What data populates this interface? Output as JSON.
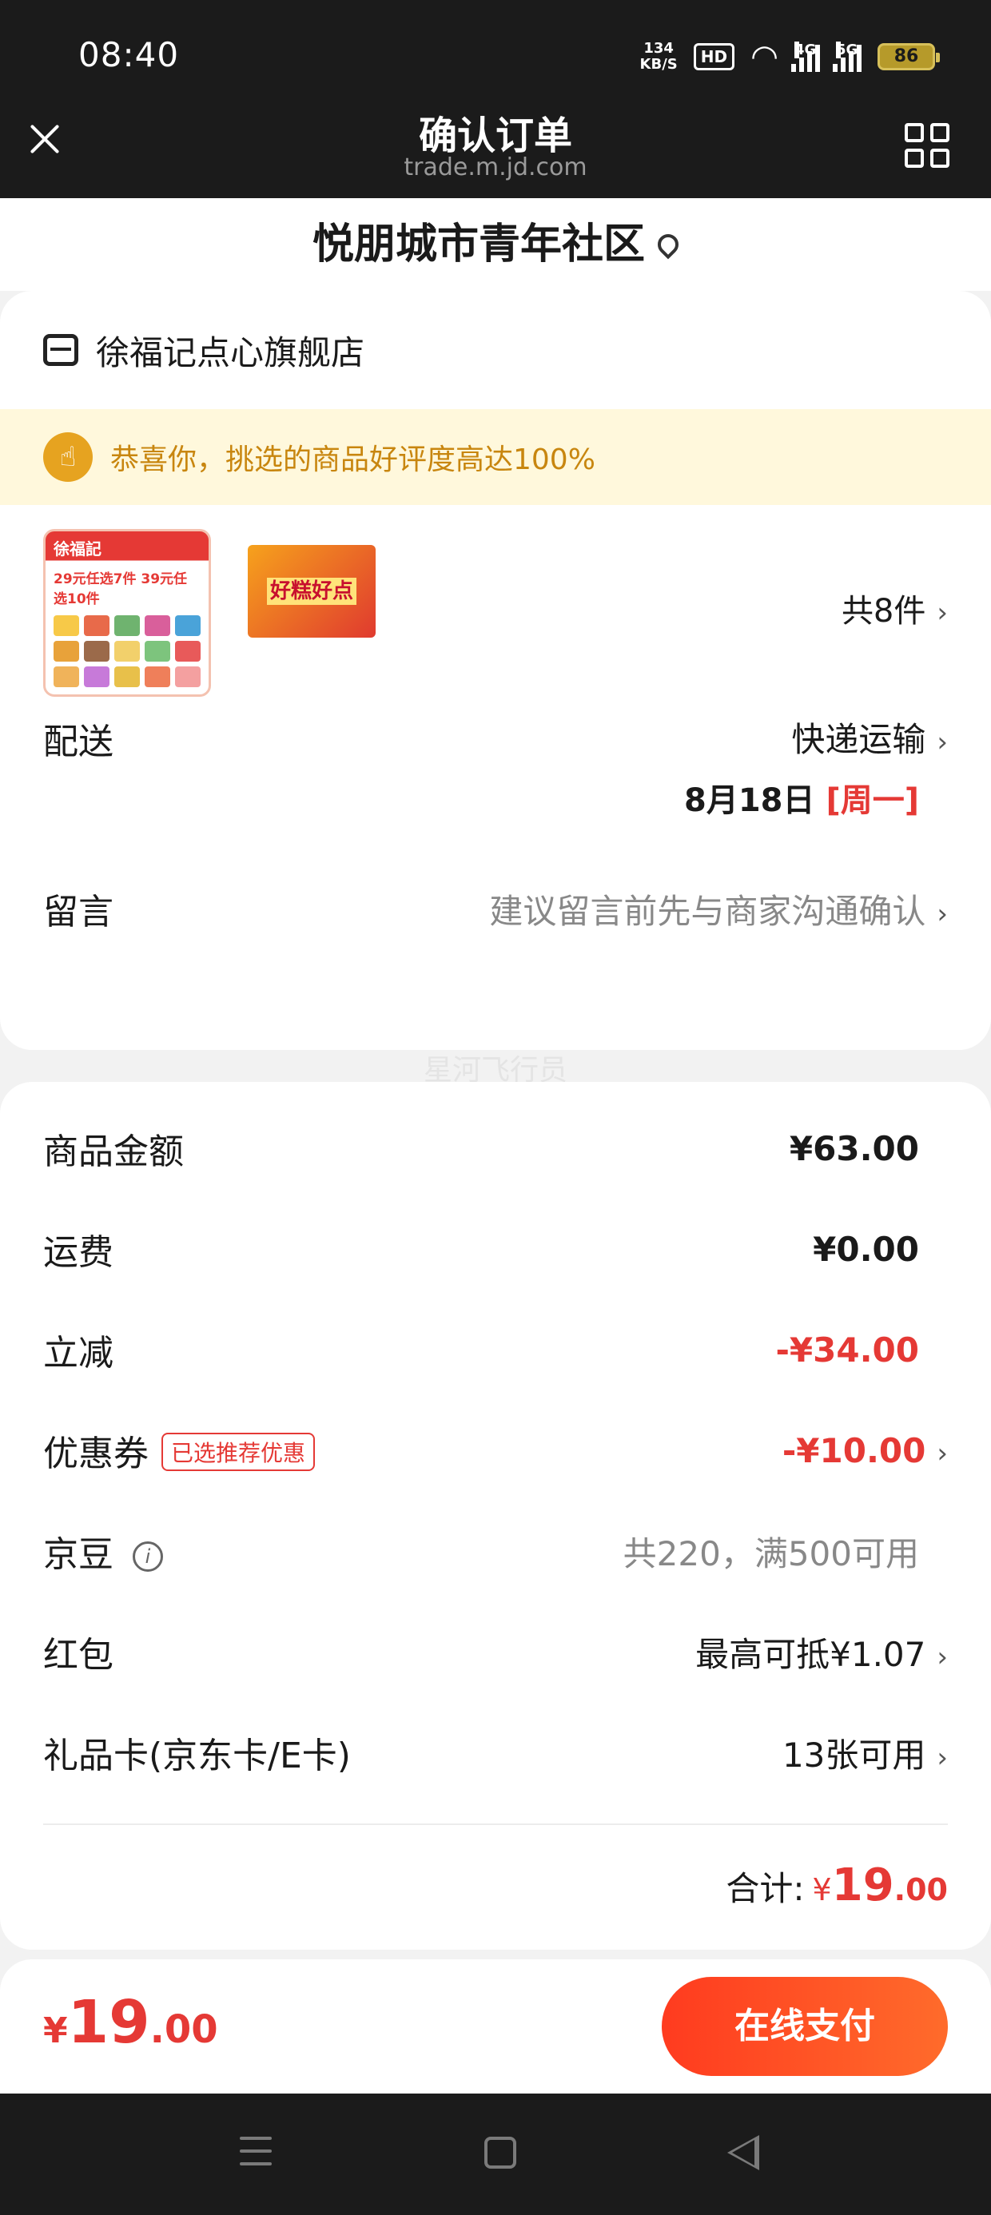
{
  "status_bar": {
    "time": "08:40",
    "speed_value": "134",
    "speed_unit": "KB/S",
    "hd_label": "HD",
    "net1_label": "4G",
    "net2_label": "5G",
    "battery": "86"
  },
  "header": {
    "title": "确认订单",
    "url": "trade.m.jd.com"
  },
  "address": {
    "name": "悦朋城市青年社区"
  },
  "store": {
    "name": "徐福记点心旗舰店"
  },
  "praise": {
    "text": "恭喜你，挑选的商品好评度高达100%"
  },
  "goods": {
    "product1_brand": "徐福記",
    "product1_promo": "29元任选7件 39元任选10件",
    "product2_title": "好糕好点",
    "count_label": "共8件"
  },
  "delivery": {
    "label": "配送",
    "method": "快递运输",
    "date": "8月18日",
    "weekday": "[周一]"
  },
  "message": {
    "label": "留言",
    "placeholder": "建议留言前先与商家沟通确认"
  },
  "watermark": "星河飞行员",
  "pricing": {
    "goods_amount_label": "商品金额",
    "goods_amount": "¥63.00",
    "shipping_label": "运费",
    "shipping": "¥0.00",
    "discount_label": "立减",
    "discount": "-¥34.00",
    "coupon_label": "优惠券",
    "coupon_badge": "已选推荐优惠",
    "coupon": "-¥10.00",
    "jingdou_label": "京豆",
    "jingdou": "共220，满500可用",
    "redpacket_label": "红包",
    "redpacket": "最高可抵¥1.07",
    "giftcard_label": "礼品卡(京东卡/E卡)",
    "giftcard": "13张可用",
    "total_label": "合计:",
    "total_currency": "¥",
    "total_int": "19",
    "total_dec": ".00"
  },
  "bottom": {
    "currency": "¥",
    "price_int": "19",
    "price_dec": ".00",
    "pay_label": "在线支付"
  },
  "colors": {
    "accent_red": "#e53935",
    "praise_bg": "#fff8dc",
    "praise_text": "#c8860f"
  }
}
